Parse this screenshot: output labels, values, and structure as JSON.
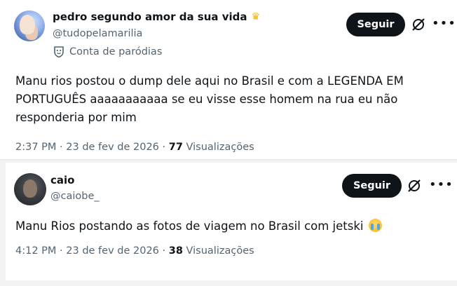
{
  "posts": [
    {
      "display_name": "pedro segundo amor da sua vida",
      "name_badge_icon": "crown-icon",
      "handle": "@tudopelamarilia",
      "parody_label": "Conta de paródias",
      "follow_label": "Seguir",
      "body": "Manu rios postou o dump dele aqui no Brasil e com a LEGENDA EM PORTUGUÊS aaaaaaaaaaa se eu visse esse homem na rua eu não responderia por mim",
      "time": "2:37 PM",
      "date": "23 de fev de 2026",
      "views_count": "77",
      "views_label": "Visualizações"
    },
    {
      "display_name": "caio",
      "handle": "@caiobe_",
      "follow_label": "Seguir",
      "body": "Manu Rios postando as fotos de viagem no Brasil com jetski",
      "body_emoji": "loudly-crying-face-emoji",
      "time": "4:12 PM",
      "date": "23 de fev de 2026",
      "views_count": "38",
      "views_label": "Visualizações"
    }
  ],
  "icons": {
    "more": "more-horizontal-icon",
    "grok": "grok-icon",
    "parody": "parody-mask-icon"
  },
  "colors": {
    "text_primary": "#0f1419",
    "text_secondary": "#536471",
    "follow_button_bg": "#0f1419",
    "follow_button_text": "#ffffff",
    "crown": "#e8b21f"
  }
}
